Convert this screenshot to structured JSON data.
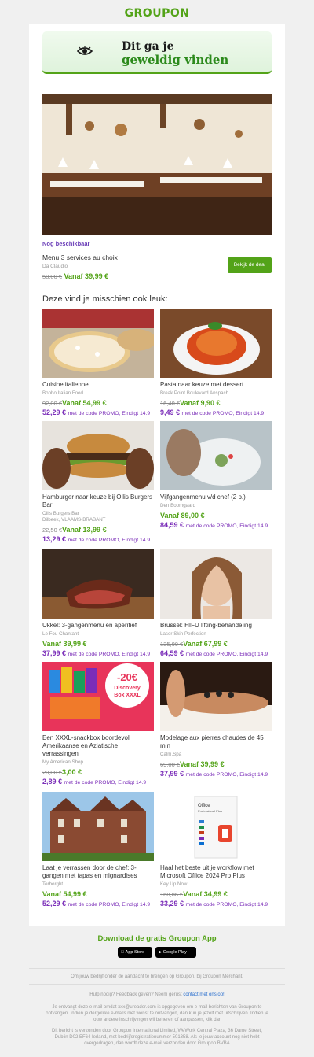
{
  "brand": {
    "logo": "GROUPON",
    "green": "#53a318",
    "purple": "#7a2db8"
  },
  "banner": {
    "line1": "Dit ga je",
    "line2": "geweldig vinden",
    "icon": "eye-icon"
  },
  "hero": {
    "availability": "Nog beschikbaar",
    "title": "Menu 3 services au choix",
    "merchant": "Da Claudio",
    "old_price": "58,00 €",
    "new_price": "Vanaf 39,99 €",
    "button": "Bekijk de deal"
  },
  "section_title": "Deze vind je misschien ook leuk:",
  "deals": [
    {
      "name": "Cuisine italienne",
      "merchant": "Boobo Italian Food",
      "location": "",
      "old": "92,00 €",
      "price": "Vanaf 54,99 €",
      "promo_price": "52,29 €",
      "promo_text": "met de code PROMO, Eindigt 14.9"
    },
    {
      "name": "Pasta naar keuze met dessert",
      "merchant": "Break Point Boulevard Anspach",
      "location": "",
      "old": "16,40 €",
      "price": "Vanaf 9,90 €",
      "promo_price": "9,49 €",
      "promo_text": "met de code PROMO, Eindigt 14.9"
    },
    {
      "name": "Hamburger naar keuze bij Ollis Burgers Bar",
      "merchant": "Ollis Burgers Bar",
      "location": "Dilbeek, VLAAMS-BRABANT",
      "old": "22,50 €",
      "price": "Vanaf 13,99 €",
      "promo_price": "13,29 €",
      "promo_text": "met de code PROMO, Eindigt 14.9"
    },
    {
      "name": "Vijfgangenmenu v/d chef (2 p.)",
      "merchant": "Den Boomgaard",
      "location": "",
      "old": "",
      "price": "Vanaf 89,00 €",
      "promo_price": "84,59 €",
      "promo_text": "met de code PROMO, Eindigt 14.9"
    },
    {
      "name": "Ukkel: 3-gangenmenu en aperitief",
      "merchant": "Le Fou Chantant",
      "location": "",
      "old": "",
      "price": "Vanaf 39,99 €",
      "promo_price": "37,99 €",
      "promo_text": "met de code PROMO, Eindigt 14.9"
    },
    {
      "name": "Brussel: HIFU lifting-behandeling",
      "merchant": "Laser Skin Perfection",
      "location": "",
      "old": "135,00 €",
      "price": "Vanaf 67,99 €",
      "promo_price": "64,59 €",
      "promo_text": "met de code PROMO, Eindigt 14.9"
    },
    {
      "name": "Een XXXL-snackbox boordevol Amerikaanse en Aziatische verrassingen",
      "merchant": "My American Shop",
      "location": "",
      "old": "20,00 €",
      "price": "3,00 €",
      "promo_price": "2,89 €",
      "promo_text": "met de code PROMO, Eindigt 14.9"
    },
    {
      "name": "Modelage aux pierres chaudes de 45 min",
      "merchant": "Calm.Spa",
      "location": "",
      "old": "69,00 €",
      "price": "Vanaf 39,99 €",
      "promo_price": "37,99 €",
      "promo_text": "met de code PROMO, Eindigt 14.9"
    },
    {
      "name": "Laat je verrassen door de chef: 3-gangen met tapas en mignardises",
      "merchant": "Terborght",
      "location": "",
      "old": "",
      "price": "Vanaf 54,99 €",
      "promo_price": "52,29 €",
      "promo_text": "met de code PROMO, Eindigt 14.9"
    },
    {
      "name": "Haal het beste uit je workflow met Microsoft Office 2024 Pro Plus",
      "merchant": "Key Up Now",
      "location": "",
      "old": "168,86 €",
      "price": "Vanaf 34,99 €",
      "promo_price": "33,29 €",
      "promo_text": "met de code PROMO, Eindigt 14.9"
    }
  ],
  "image_texts": {
    "snackbox_badge_1": "-20€",
    "snackbox_badge_2": "Discovery",
    "snackbox_badge_3": "Box XXXL",
    "office_title": "Office",
    "office_sub": "Professional Plus"
  },
  "footer": {
    "app_title": "Download de gratis Groupon App",
    "appstore_small": "Download on the",
    "appstore": "App Store",
    "googleplay_small": "GET IT ON",
    "googleplay": "Google Play",
    "note": "Om jouw bedrijf onder de aandacht te brengen op Groupon, bij Groupon Merchant.",
    "help": "Hulp nodig? Feedback geven? Neem gerust",
    "help_link": "contact met ons op!",
    "legal1": "Je ontvangt deze e-mail omdat xxx@ureader.com is opgegeven om e-mail berichten van Groupon te ontvangen. Indien je dergelijke e-mails niet wenst te ontvangen, dan kun je jezelf met uitschrijven. Indien je jouw andere inschrijvingen wil beheren of aanpassen, klik dan",
    "legal2": "Dit bericht is verzonden door Groupon International Limited, WeWork Central Plaza, 36 Dame Street, Dublin D02 EF64 Ierland, met bedrijfsregistratienummer 501358. Als je jouw account nog niet hebt overgedragen, dan wordt deze e-mail verzonden door Groupon BVBA"
  }
}
